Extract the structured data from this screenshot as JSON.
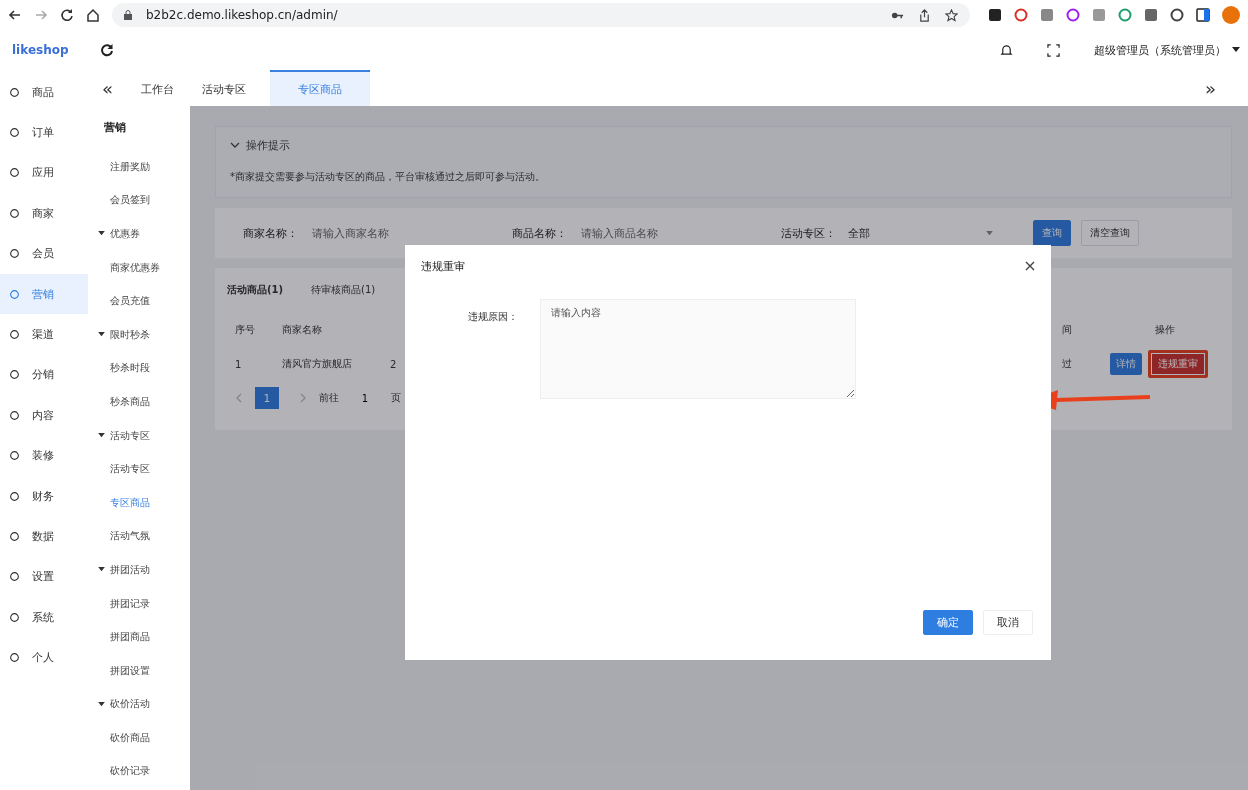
{
  "browser": {
    "url": "b2b2c.demo.likeshop.cn/admin/"
  },
  "app": {
    "logo": "likeshop",
    "user": "超级管理员（系统管理员）"
  },
  "nav": [
    {
      "label": "商品",
      "selected": false
    },
    {
      "label": "订单",
      "selected": false
    },
    {
      "label": "应用",
      "selected": false
    },
    {
      "label": "商家",
      "selected": false
    },
    {
      "label": "会员",
      "selected": false
    },
    {
      "label": "营销",
      "selected": true
    },
    {
      "label": "渠道",
      "selected": false
    },
    {
      "label": "分销",
      "selected": false
    },
    {
      "label": "内容",
      "selected": false
    },
    {
      "label": "装修",
      "selected": false
    },
    {
      "label": "财务",
      "selected": false
    },
    {
      "label": "数据",
      "selected": false
    },
    {
      "label": "设置",
      "selected": false
    },
    {
      "label": "系统",
      "selected": false
    },
    {
      "label": "个人",
      "selected": false
    }
  ],
  "tabs_bar": {
    "collapse": "«",
    "expand": "»",
    "tabs": [
      {
        "label": "工作台",
        "selected": false
      },
      {
        "label": "活动专区",
        "selected": false
      },
      {
        "label": "专区商品",
        "selected": true
      }
    ]
  },
  "submenu": {
    "title": "营销",
    "items": [
      {
        "label": "注册奖励",
        "selected": false
      },
      {
        "label": "会员签到",
        "selected": false
      },
      {
        "label": "优惠券",
        "expanded": true,
        "children": [
          {
            "label": "商家优惠券",
            "selected": false
          },
          {
            "label": "会员充值",
            "selected": false
          }
        ]
      },
      {
        "label": "限时秒杀",
        "expanded": true,
        "children": [
          {
            "label": "秒杀时段",
            "selected": false
          },
          {
            "label": "秒杀商品",
            "selected": false
          }
        ]
      },
      {
        "label": "活动专区",
        "expanded": true,
        "children": [
          {
            "label": "活动专区",
            "selected": false
          },
          {
            "label": "专区商品",
            "selected": true
          },
          {
            "label": "活动气氛",
            "selected": false
          }
        ]
      },
      {
        "label": "拼团活动",
        "expanded": true,
        "children": [
          {
            "label": "拼团记录",
            "selected": false
          },
          {
            "label": "拼团商品",
            "selected": false
          },
          {
            "label": "拼团设置",
            "selected": false
          }
        ]
      },
      {
        "label": "砍价活动",
        "expanded": true,
        "children": [
          {
            "label": "砍价商品",
            "selected": false
          },
          {
            "label": "砍价记录",
            "selected": false
          }
        ]
      }
    ]
  },
  "tip": {
    "title": "操作提示",
    "expanded": true,
    "text": "*商家提交需要参与活动专区的商品，平台审核通过之后即可参与活动。"
  },
  "filters": [
    {
      "label": "商家名称：",
      "placeholder": "请输入商家名称",
      "kind": "input"
    },
    {
      "label": "商品名称：",
      "placeholder": "请输入商品名称",
      "kind": "input"
    },
    {
      "label": "活动专区：",
      "value": "全部",
      "kind": "select"
    }
  ],
  "filter_buttons": [
    {
      "label": "查询",
      "kind": "primary"
    },
    {
      "label": "清空查询",
      "kind": "plain"
    }
  ],
  "list_tabs": [
    {
      "label": "活动商品(1)",
      "selected": true
    },
    {
      "label": "待审核商品(1)",
      "selected": false
    }
  ],
  "table": {
    "columns": [
      "序号",
      "商家名称",
      "",
      "间",
      "操作"
    ],
    "rows": [
      {
        "cells": [
          "1",
          "清风官方旗舰店",
          "2",
          "过"
        ],
        "actions": [
          {
            "label": "详情",
            "kind": "primary",
            "highlighted": false
          },
          {
            "label": "违规重审",
            "kind": "danger",
            "highlighted": true
          }
        ]
      }
    ]
  },
  "pagination": {
    "pages": [
      {
        "label": "1",
        "selected": true
      }
    ],
    "jump_label": "前往",
    "jump_value": "1",
    "jump_suffix": "页"
  },
  "dialog": {
    "title": "违规重审",
    "field_label": "违规原因：",
    "placeholder": "请输入内容",
    "buttons": [
      {
        "label": "确定",
        "kind": "primary"
      },
      {
        "label": "取消",
        "kind": "plain"
      }
    ]
  }
}
